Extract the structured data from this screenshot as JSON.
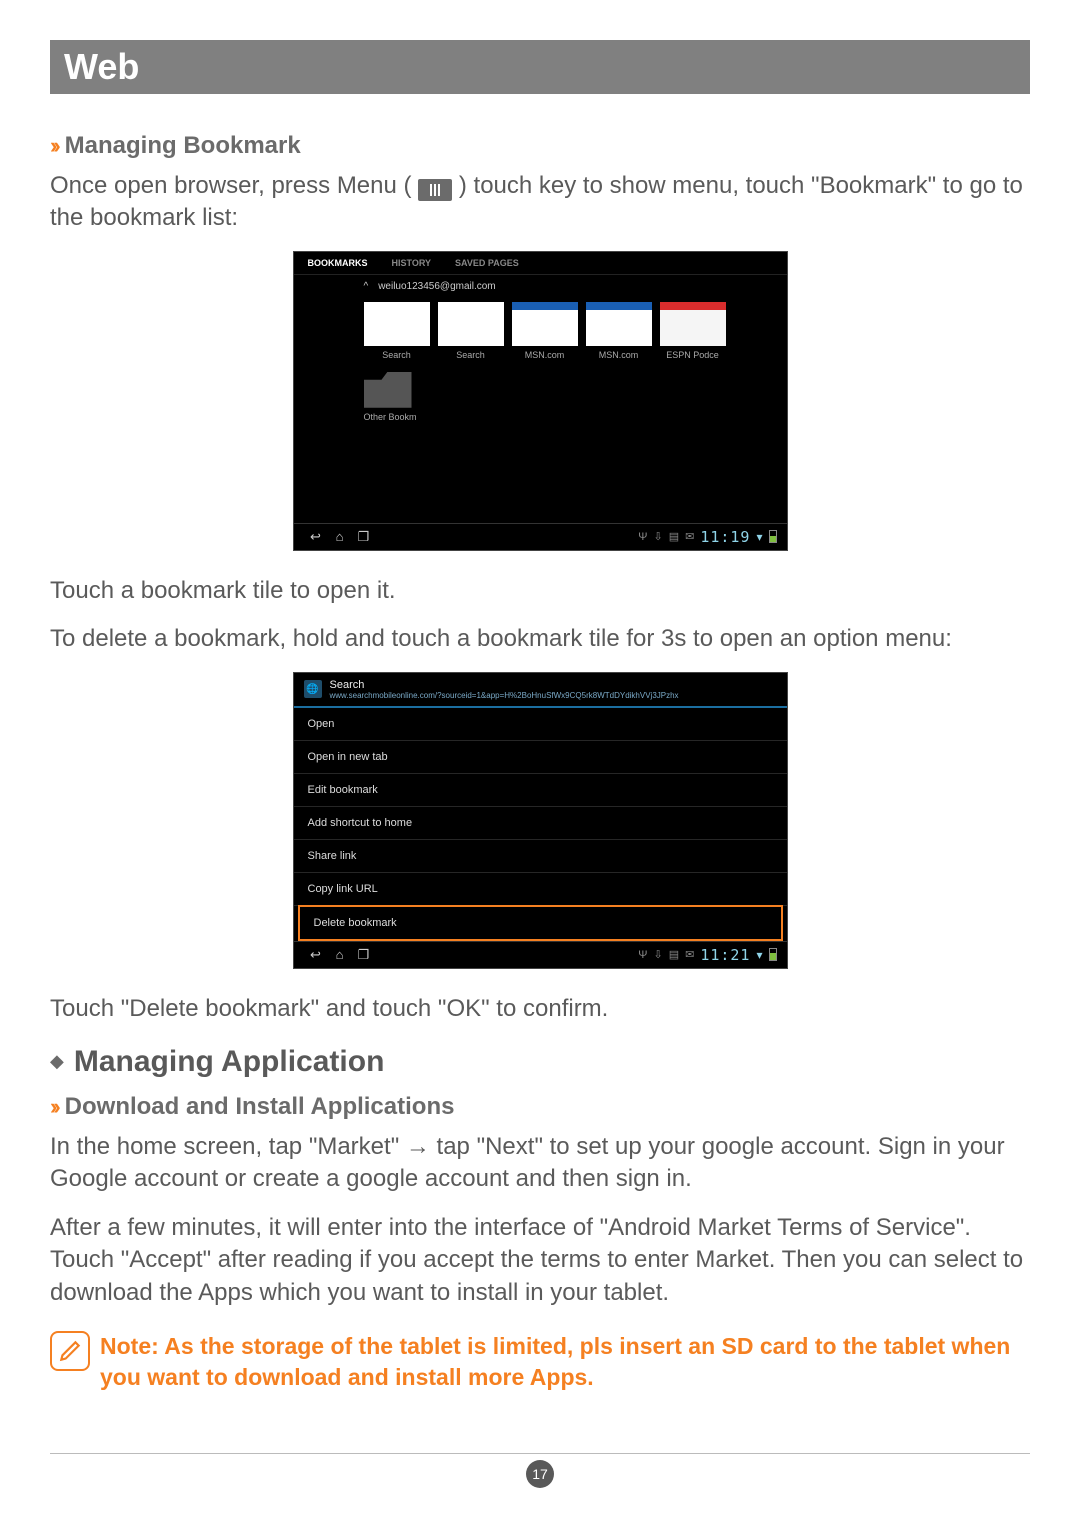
{
  "header": {
    "title": "Web"
  },
  "sub1": {
    "title": "Managing Bookmark"
  },
  "p1a": "Once open browser, press Menu (",
  "p1b": ") touch key to show menu, touch \"Bookmark\" to go to the bookmark list:",
  "ss1": {
    "tabs": {
      "bookmarks": "BOOKMARKS",
      "history": "HISTORY",
      "saved": "SAVED PAGES"
    },
    "account": "weiluo123456@gmail.com",
    "thumbs": [
      "Search",
      "Search",
      "MSN.com",
      "MSN.com",
      "ESPN Podce"
    ],
    "folder": "Other Bookm",
    "time": "11:19"
  },
  "p2": "Touch a bookmark tile to open it.",
  "p3": "To delete a bookmark, hold and touch a bookmark tile for 3s to open an option menu:",
  "ss2": {
    "title": "Search",
    "url": "www.searchmobileonline.com/?sourceid=1&app=H%2BoHnuSfWx9CQ5rk8WTdDYdikhVVj3JPzhx",
    "items": [
      "Open",
      "Open in new tab",
      "Edit bookmark",
      "Add shortcut to home",
      "Share link",
      "Copy link URL",
      "Delete bookmark"
    ],
    "time": "11:21"
  },
  "p4": "Touch \"Delete bookmark\" and touch \"OK\" to confirm.",
  "section2": {
    "title": "Managing Application"
  },
  "sub2": {
    "title": "Download and Install Applications"
  },
  "p5a": "In the home screen, tap \"Market\" ",
  "p5b": " tap \"Next\" to set up your google account. Sign in your Google account or create a google account and then sign in.",
  "p6": "After a few minutes, it will enter into the interface of \"Android Market Terms of Service\". Touch \"Accept\" after reading if you accept the terms to enter Market. Then you can select to download the Apps which you want to install in your tablet.",
  "note": "Note: As the storage of the tablet is limited, pls insert an SD card to the tablet when you want to download and install more Apps.",
  "page_number": "17"
}
